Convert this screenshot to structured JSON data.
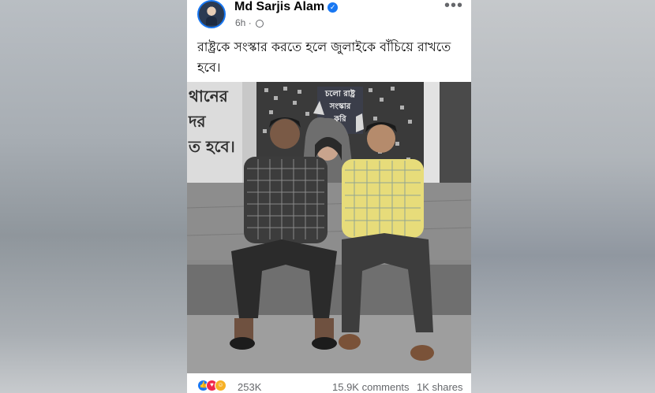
{
  "post": {
    "author": "Md Sarjis Alam",
    "time": "6h",
    "privacy_icon": "globe-icon",
    "more_icon": "more-options-icon",
    "caption": "রাষ্ট্রকে সংস্কার করতে হলে জুলাইকে বাঁচিয়ে রাখতে হবে।",
    "photo": {
      "wall_text_left": [
        "থানের",
        "দর",
        "ত হবে।"
      ],
      "poster_text": [
        "চলো রাষ্ট্র",
        "সংস্কার",
        "করি"
      ]
    }
  },
  "stats": {
    "reactions_count": "253K",
    "comments": "15.9K comments",
    "shares": "1K shares",
    "reaction_icons": [
      "like-icon",
      "love-icon",
      "care-icon"
    ]
  },
  "colors": {
    "accent": "#1877f2",
    "text": "#050505",
    "muted": "#65676b"
  }
}
